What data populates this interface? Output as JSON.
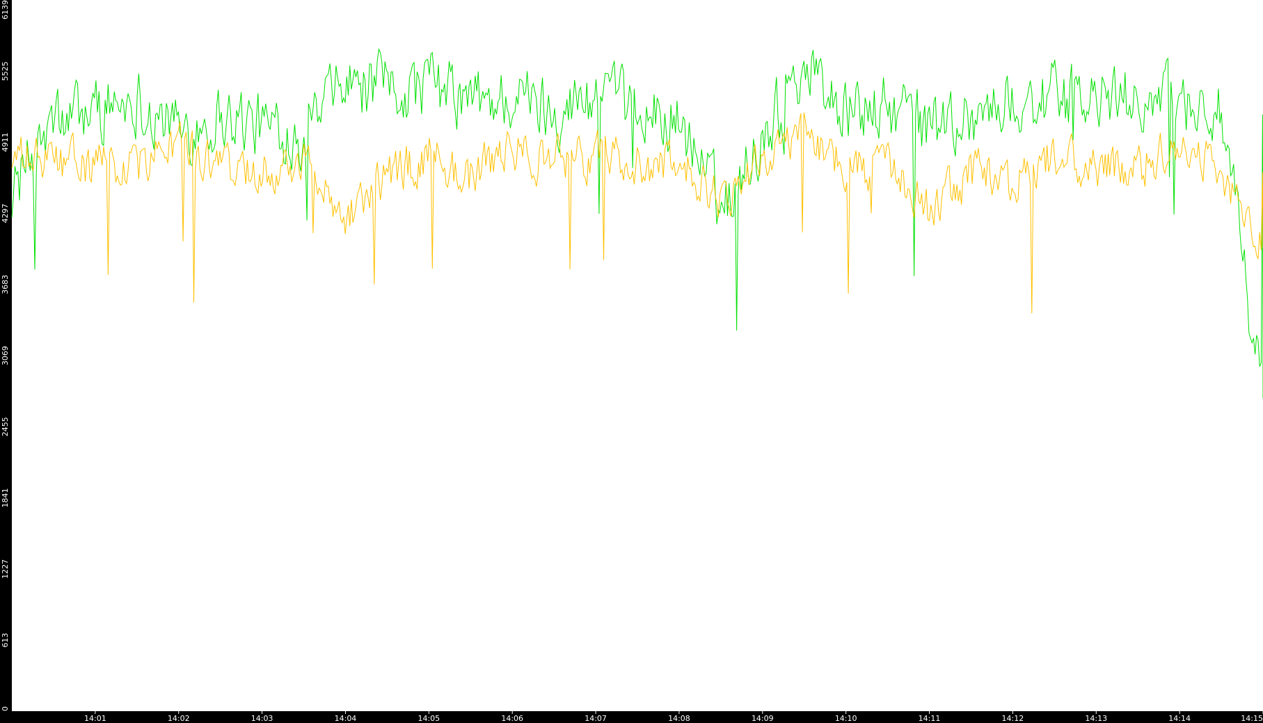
{
  "chart_data": {
    "type": "line",
    "title": "",
    "xlabel": "",
    "ylabel": "",
    "ylim": [
      0,
      6139
    ],
    "xlim": [
      "14:00:00",
      "14:15:00"
    ],
    "y_ticks": [
      "0",
      "613",
      "1227",
      "1841",
      "2455",
      "3069",
      "3683",
      "4297",
      "4911",
      "5525",
      "6139"
    ],
    "x_ticks": [
      "14:01",
      "14:02",
      "14:03",
      "14:04",
      "14:05",
      "14:06",
      "14:07",
      "14:08",
      "14:09",
      "14:10",
      "14:11",
      "14:12",
      "14:13",
      "14:14",
      "14:15"
    ],
    "grid": false,
    "legend": "none",
    "background": "#ffffff",
    "axis_color": "#000000",
    "series": [
      {
        "color": "#00e000",
        "x": [
          "14:00:00",
          "14:00:30",
          "14:01:00",
          "14:01:30",
          "14:02:00",
          "14:02:30",
          "14:03:00",
          "14:03:30",
          "14:04:00",
          "14:04:30",
          "14:05:00",
          "14:05:30",
          "14:06:00",
          "14:06:30",
          "14:07:00",
          "14:07:30",
          "14:08:00",
          "14:08:30",
          "14:09:00",
          "14:09:30",
          "14:10:00",
          "14:10:30",
          "14:11:00",
          "14:11:30",
          "14:12:00",
          "14:12:30",
          "14:13:00",
          "14:13:30",
          "14:14:00",
          "14:14:30",
          "14:15:00"
        ],
        "values": [
          4500,
          5050,
          5200,
          5300,
          5000,
          5150,
          5050,
          5000,
          5400,
          5350,
          5400,
          5250,
          5300,
          5200,
          5300,
          5150,
          5100,
          4350,
          4950,
          5600,
          5150,
          5200,
          5050,
          5150,
          5250,
          5300,
          5250,
          5300,
          5250,
          5150,
          2700
        ]
      },
      {
        "color": "#ffc000",
        "x": [
          "14:00:00",
          "14:00:30",
          "14:01:00",
          "14:01:30",
          "14:02:00",
          "14:02:30",
          "14:03:00",
          "14:03:30",
          "14:04:00",
          "14:04:30",
          "14:05:00",
          "14:05:30",
          "14:06:00",
          "14:06:30",
          "14:07:00",
          "14:07:30",
          "14:08:00",
          "14:08:30",
          "14:09:00",
          "14:09:30",
          "14:10:00",
          "14:10:30",
          "14:11:00",
          "14:11:30",
          "14:12:00",
          "14:12:30",
          "14:13:00",
          "14:13:30",
          "14:14:00",
          "14:14:30",
          "14:15:00"
        ],
        "values": [
          4750,
          4750,
          4700,
          4700,
          4900,
          4650,
          4700,
          4750,
          4300,
          4600,
          4800,
          4600,
          4850,
          4750,
          4800,
          4700,
          4750,
          4400,
          4800,
          4950,
          4750,
          4650,
          4300,
          4650,
          4550,
          4800,
          4650,
          4700,
          4900,
          4650,
          4000
        ]
      }
    ]
  }
}
